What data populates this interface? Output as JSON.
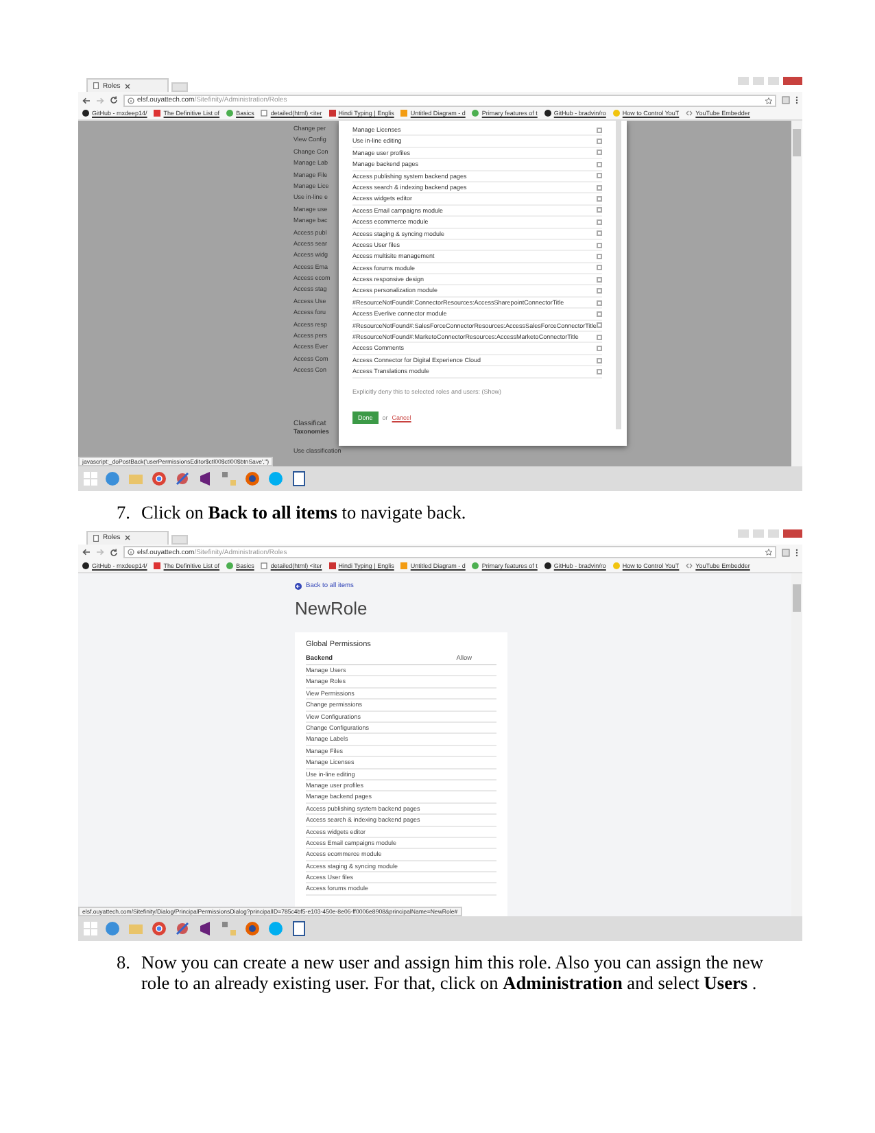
{
  "screenshot_1": {
    "tab": {
      "title": "Roles"
    },
    "address": {
      "host": "elsf.ouyattech.com",
      "path": "/Sitefinity/Administration/Roles"
    },
    "bookmarks": [
      {
        "label": "GitHub - mxdeep14/"
      },
      {
        "label": "The Definitive List of"
      },
      {
        "label": "Basics"
      },
      {
        "label": "detailed(html) <iter"
      },
      {
        "label": "Hindi Typing | Englis"
      },
      {
        "label": "Untitled Diagram - d"
      },
      {
        "label": "Primary features of t"
      },
      {
        "label": "GitHub - bradvin/ro"
      },
      {
        "label": "How to Control YouT"
      },
      {
        "label": "YouTube Embedder"
      }
    ],
    "background_list": [
      "Change per",
      "View Config",
      "Change Con",
      "Manage Lab",
      "Manage File",
      "Manage Lice",
      "Use in-line e",
      "Manage use",
      "Manage bac",
      "Access publ",
      "Access sear",
      "Access widg",
      "Access Ema",
      "Access ecom",
      "Access stag",
      "Access Use",
      "Access foru",
      "Access resp",
      "Access pers",
      "Access Ever",
      "Access Com",
      "Access Con"
    ],
    "background_section": {
      "title": "Classificat",
      "subtitle": "Taxonomies",
      "item": "Use classification"
    },
    "dialog": {
      "permissions": [
        {
          "label": "Manage Licenses",
          "checked": false
        },
        {
          "label": "Use in-line editing",
          "checked": false
        },
        {
          "label": "Manage user profiles",
          "checked": false
        },
        {
          "label": "Manage backend pages",
          "checked": false
        },
        {
          "label": "Access publishing system backend pages",
          "checked": false
        },
        {
          "label": "Access search & indexing backend pages",
          "checked": false
        },
        {
          "label": "Access widgets editor",
          "checked": false
        },
        {
          "label": "Access Email campaigns module",
          "checked": false
        },
        {
          "label": "Access ecommerce module",
          "checked": false
        },
        {
          "label": "Access staging & syncing module",
          "checked": false
        },
        {
          "label": "Access User files",
          "checked": false
        },
        {
          "label": "Access multisite management",
          "checked": false
        },
        {
          "label": "Access forums module",
          "checked": false
        },
        {
          "label": "Access responsive design",
          "checked": false
        },
        {
          "label": "Access personalization module",
          "checked": false
        },
        {
          "label": "#ResourceNotFound#:ConnectorResources:AccessSharepointConnectorTitle",
          "checked": false
        },
        {
          "label": "Access Everlive connector module",
          "checked": false
        },
        {
          "label": "#ResourceNotFound#:SalesForceConnectorResources:AccessSalesForceConnectorTitle",
          "checked": false
        },
        {
          "label": "#ResourceNotFound#:MarketoConnectorResources:AccessMarketoConnectorTitle",
          "checked": false
        },
        {
          "label": "Access Comments",
          "checked": false
        },
        {
          "label": "Access Connector for Digital Experience Cloud",
          "checked": false
        },
        {
          "label": "Access Translations module",
          "checked": false
        }
      ],
      "deny_text": "Explicitly deny this to selected roles and users:",
      "show_link": "(Show)",
      "done_button": "Done",
      "or_text": "or",
      "cancel_link": "Cancel"
    },
    "status_url": "javascript:_doPostBack('userPermissionsEditor$ctl00$ctl00$btnSave','')"
  },
  "step_7": {
    "number": "7.",
    "text": "Click on **Back to all items** to navigate back."
  },
  "screenshot_2": {
    "tab": {
      "title": "Roles"
    },
    "address": {
      "host": "elsf.ouyattech.com",
      "path": "/Sitefinity/Administration/Roles"
    },
    "bookmarks": [
      {
        "label": "GitHub - mxdeep14/"
      },
      {
        "label": "The Definitive List of"
      },
      {
        "label": "Basics"
      },
      {
        "label": "detailed(html) <iter"
      },
      {
        "label": "Hindi Typing | Englis"
      },
      {
        "label": "Untitled Diagram - d"
      },
      {
        "label": "Primary features of t"
      },
      {
        "label": "GitHub - bradvin/ro"
      },
      {
        "label": "How to Control YouT"
      },
      {
        "label": "YouTube Embedder"
      }
    ],
    "back_link": "Back to all items",
    "page_title": "NewRole",
    "permissions_card": {
      "title": "Global Permissions",
      "columns": [
        "Backend",
        "Allow"
      ],
      "rows": [
        "Manage Users",
        "Manage Roles",
        "View Permissions",
        "Change permissions",
        "View Configurations",
        "Change Configurations",
        "Manage Labels",
        "Manage Files",
        "Manage Licenses",
        "Use in-line editing",
        "Manage user profiles",
        "Manage backend pages",
        "Access publishing system backend pages",
        "Access search & indexing backend pages",
        "Access widgets editor",
        "Access Email campaigns module",
        "Access ecommerce module",
        "Access staging & syncing module",
        "Access User files",
        "Access forums module"
      ]
    },
    "status_url": "elsf.ouyattech.com/Sitefinity/Dialog/PrincipalPermissionsDialog?principalID=785c4bf5-e103-450e-8e06-ff0006e8908&principalName=NewRole#"
  },
  "step_8": {
    "number": "8.",
    "text": "Now you can create a new user and assign him this role. Also you can assign the new role to an already existing user. For that, click on **Administration** and select **Users** ."
  }
}
